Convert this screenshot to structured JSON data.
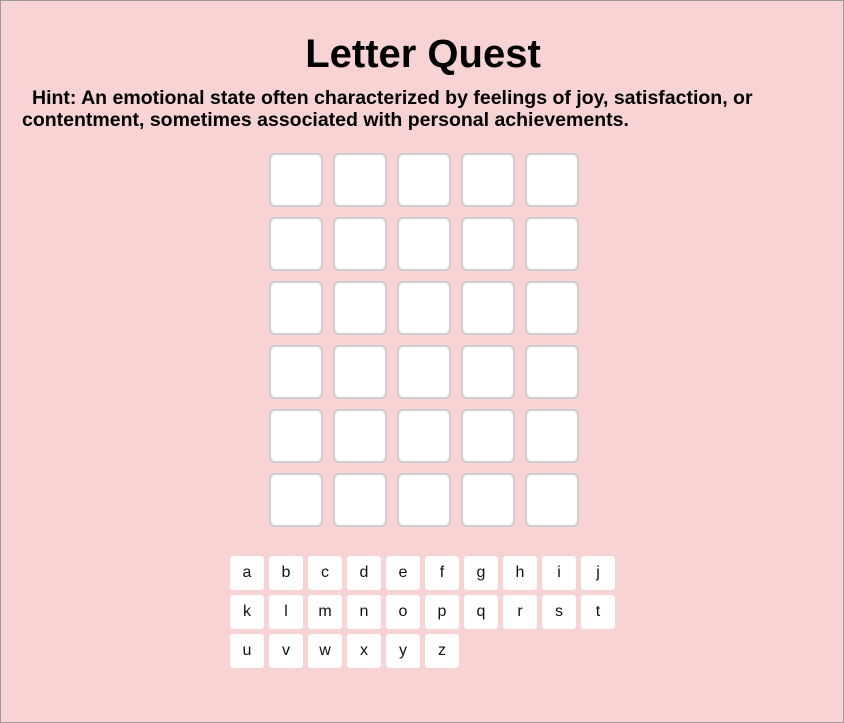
{
  "game": {
    "title": "Letter Quest",
    "hint": "Hint: An emotional state often characterized by feelings of joy, satisfaction, or contentment, sometimes associated with personal achievements."
  },
  "board": {
    "rows": [
      [
        "",
        "",
        "",
        "",
        ""
      ],
      [
        "",
        "",
        "",
        "",
        ""
      ],
      [
        "",
        "",
        "",
        "",
        ""
      ],
      [
        "",
        "",
        "",
        "",
        ""
      ],
      [
        "",
        "",
        "",
        "",
        ""
      ],
      [
        "",
        "",
        "",
        "",
        ""
      ]
    ]
  },
  "keyboard": {
    "rows": [
      [
        "a",
        "b",
        "c",
        "d",
        "e",
        "f",
        "g",
        "h",
        "i",
        "j"
      ],
      [
        "k",
        "l",
        "m",
        "n",
        "o",
        "p",
        "q",
        "r",
        "s",
        "t"
      ],
      [
        "u",
        "v",
        "w",
        "x",
        "y",
        "z"
      ]
    ]
  },
  "colors": {
    "background": "#f7d3d4",
    "tile": "#ffffff",
    "tile_border": "#cfcfcf"
  }
}
